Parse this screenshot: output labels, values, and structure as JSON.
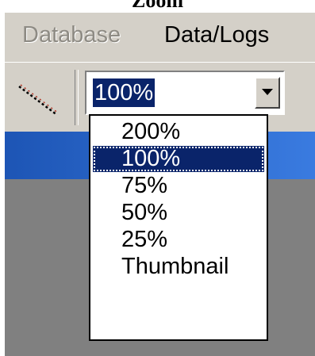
{
  "caption": {
    "title": "Zoom"
  },
  "menubar": {
    "items": [
      {
        "label": "Database",
        "enabled": false
      },
      {
        "label": "Data/Logs",
        "enabled": true
      }
    ]
  },
  "toolbar": {
    "tool_icon": "line-tool-icon",
    "zoom": {
      "value": "100%",
      "dropdown_icon": "chevron-down-icon"
    }
  },
  "dropdown": {
    "options": [
      "200%",
      "100%",
      "75%",
      "50%",
      "25%",
      "Thumbnail"
    ],
    "selected": "100%"
  },
  "colors": {
    "window_face": "#d4d0c8",
    "highlight": "#0a246a",
    "title_blue": "#1d55b5",
    "workspace": "#808080"
  }
}
